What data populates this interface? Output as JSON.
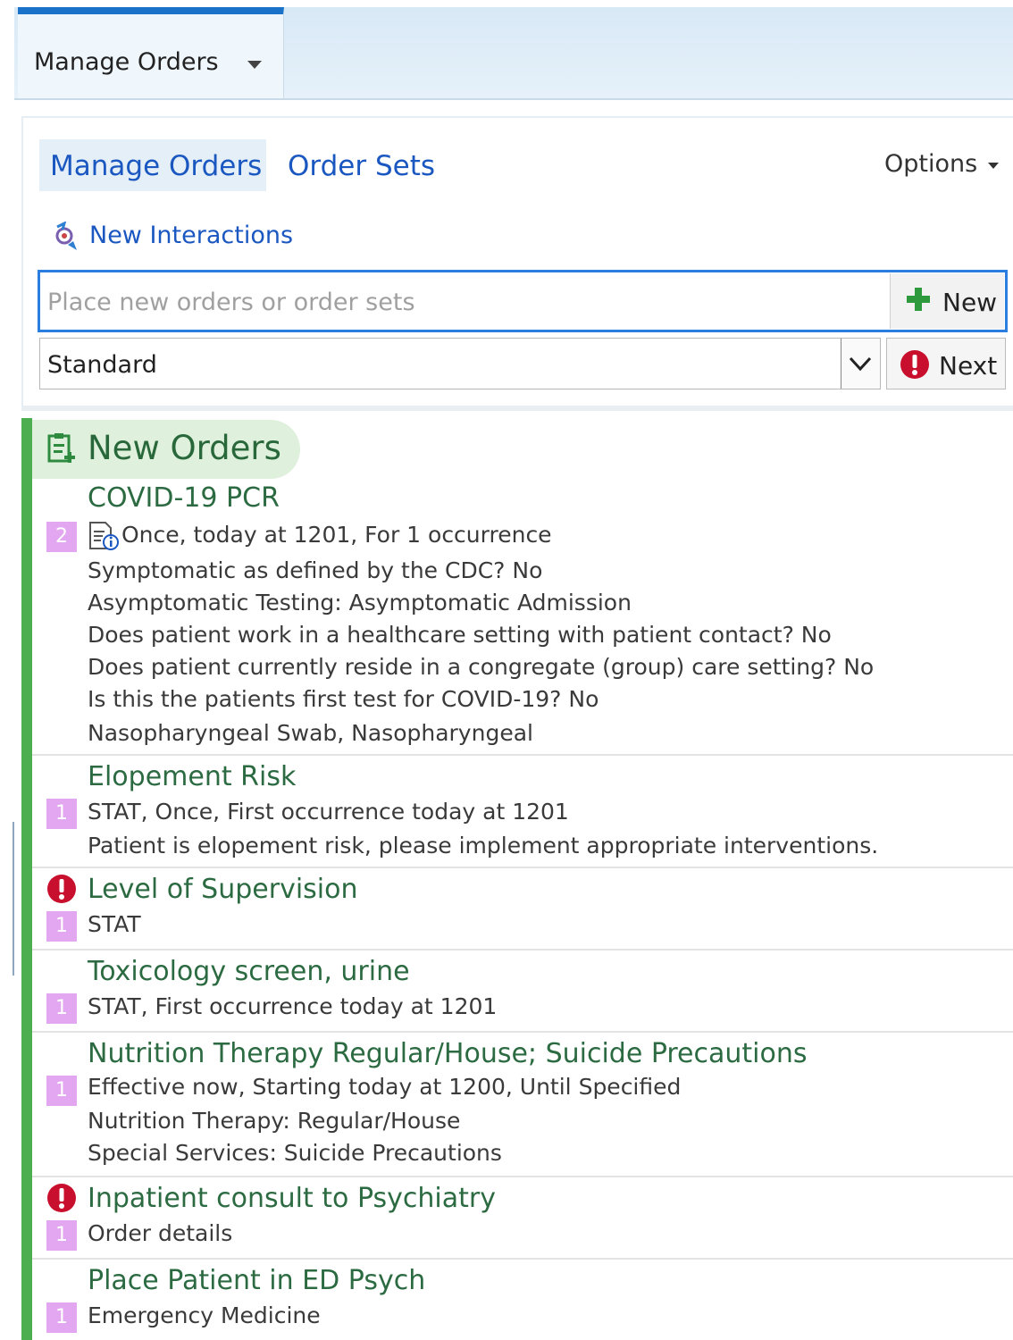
{
  "tab": {
    "label": "Manage Orders"
  },
  "subtabs": {
    "manage_orders": "Manage Orders",
    "order_sets": "Order Sets",
    "options": "Options"
  },
  "interactions": {
    "label": "New Interactions"
  },
  "search": {
    "placeholder": "Place new orders or order sets",
    "new_label": "New"
  },
  "mode_select": {
    "value": "Standard"
  },
  "next_button": {
    "label": "Next"
  },
  "section": {
    "title": "New Orders"
  },
  "orders": [
    {
      "title": "COVID-19 PCR",
      "badge": "2",
      "lines": [
        "Once, today at 1201, For 1 occurrence",
        "Symptomatic as defined by the CDC? No",
        "Asymptomatic Testing: Asymptomatic Admission",
        "Does patient work in a healthcare setting with patient contact? No",
        "Does patient currently reside in a congregate (group) care setting? No",
        "Is this the patients first test for COVID-19? No",
        "Nasopharyngeal Swab, Nasopharyngeal"
      ]
    },
    {
      "title": "Elopement Risk",
      "badge": "1",
      "lines": [
        "STAT,  Once, First occurrence today at 1201",
        "Patient is elopement risk, please implement appropriate interventions."
      ]
    },
    {
      "title": "Level of Supervision",
      "badge": "1",
      "lines": [
        "STAT"
      ]
    },
    {
      "title": "Toxicology screen, urine",
      "badge": "1",
      "lines": [
        "STAT, First occurrence today at 1201"
      ]
    },
    {
      "title": "Nutrition Therapy Regular/House; Suicide Precautions",
      "badge": "1",
      "lines": [
        "Effective now, Starting today at 1200, Until Specified",
        "Nutrition Therapy: Regular/House",
        "Special Services: Suicide Precautions"
      ]
    },
    {
      "title": "Inpatient consult to Psychiatry",
      "badge": "1",
      "lines": [
        "Order details"
      ]
    },
    {
      "title": "Place Patient in ED Psych",
      "badge": "1",
      "lines": [
        "Emergency Medicine"
      ]
    }
  ],
  "colors": {
    "accent_blue": "#1a57c0",
    "green_bar": "#4cae4f",
    "badge": "#e3a6f0",
    "warning_red": "#c8102e"
  }
}
